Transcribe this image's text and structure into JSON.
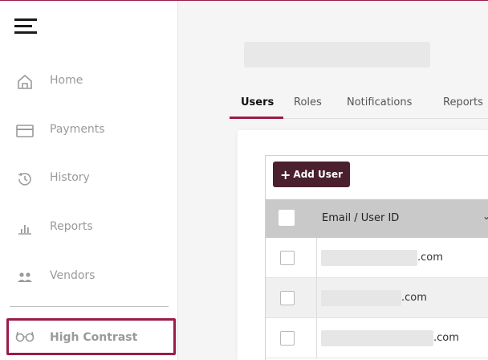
{
  "sidebar": {
    "items": [
      {
        "label": "Home",
        "icon": "home-icon"
      },
      {
        "label": "Payments",
        "icon": "credit-card-icon"
      },
      {
        "label": "History",
        "icon": "history-icon"
      },
      {
        "label": "Reports",
        "icon": "bar-chart-icon"
      },
      {
        "label": "Vendors",
        "icon": "vendors-icon"
      }
    ],
    "high_contrast": {
      "label": "High Contrast",
      "icon": "glasses-icon"
    }
  },
  "tabs": [
    {
      "label": "Users",
      "active": true
    },
    {
      "label": "Roles",
      "active": false
    },
    {
      "label": "Notifications",
      "active": false
    },
    {
      "label": "Reports",
      "active": false
    }
  ],
  "users_table": {
    "add_button_label": "Add User",
    "columns": [
      "Email / User ID"
    ],
    "rows": [
      {
        "email_suffix": ".com"
      },
      {
        "email_suffix": ".com"
      },
      {
        "email_suffix": ".com"
      }
    ]
  },
  "colors": {
    "accent": "#9b1b4a",
    "button_bg": "#4a1f2e",
    "header_bg": "#c9c9c9"
  }
}
